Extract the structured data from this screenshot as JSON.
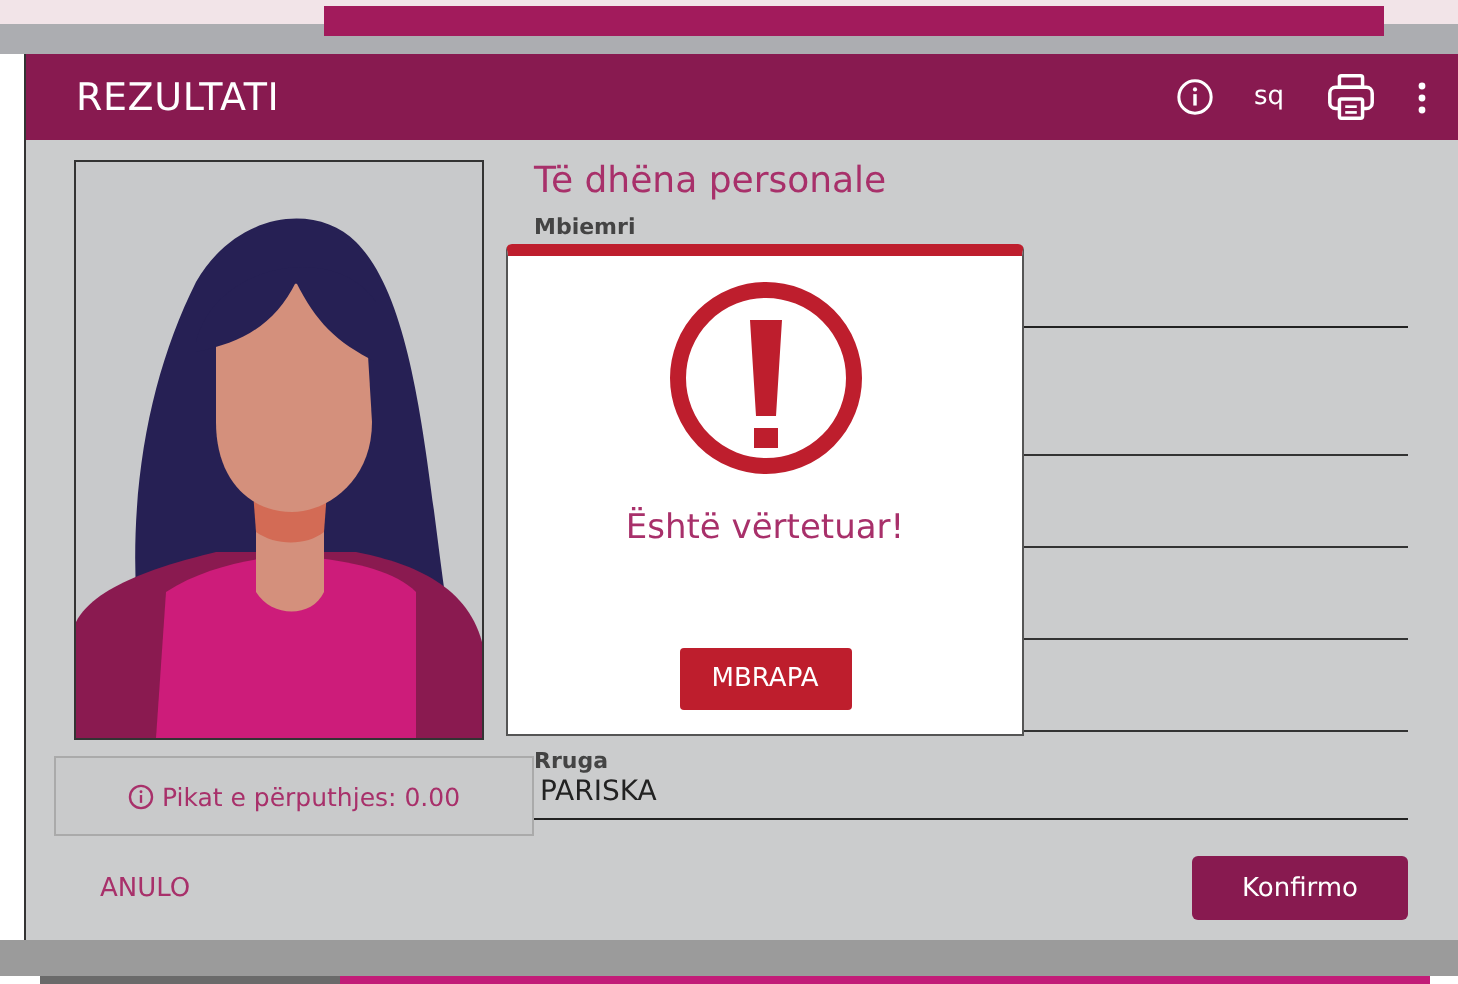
{
  "header": {
    "title": "REZULTATI",
    "language": "sq"
  },
  "section_title": "Të dhëna personale",
  "fields": [
    {
      "label": "Mbiemri"
    },
    {
      "label": "Rruga",
      "value": "PARISKA"
    }
  ],
  "match_score": "Pikat e përputhjes: 0.00",
  "buttons": {
    "cancel": "ANULO",
    "confirm": "Konfirmo"
  },
  "dialog": {
    "message": "Është vërtetuar!",
    "button": "MBRAPA"
  }
}
